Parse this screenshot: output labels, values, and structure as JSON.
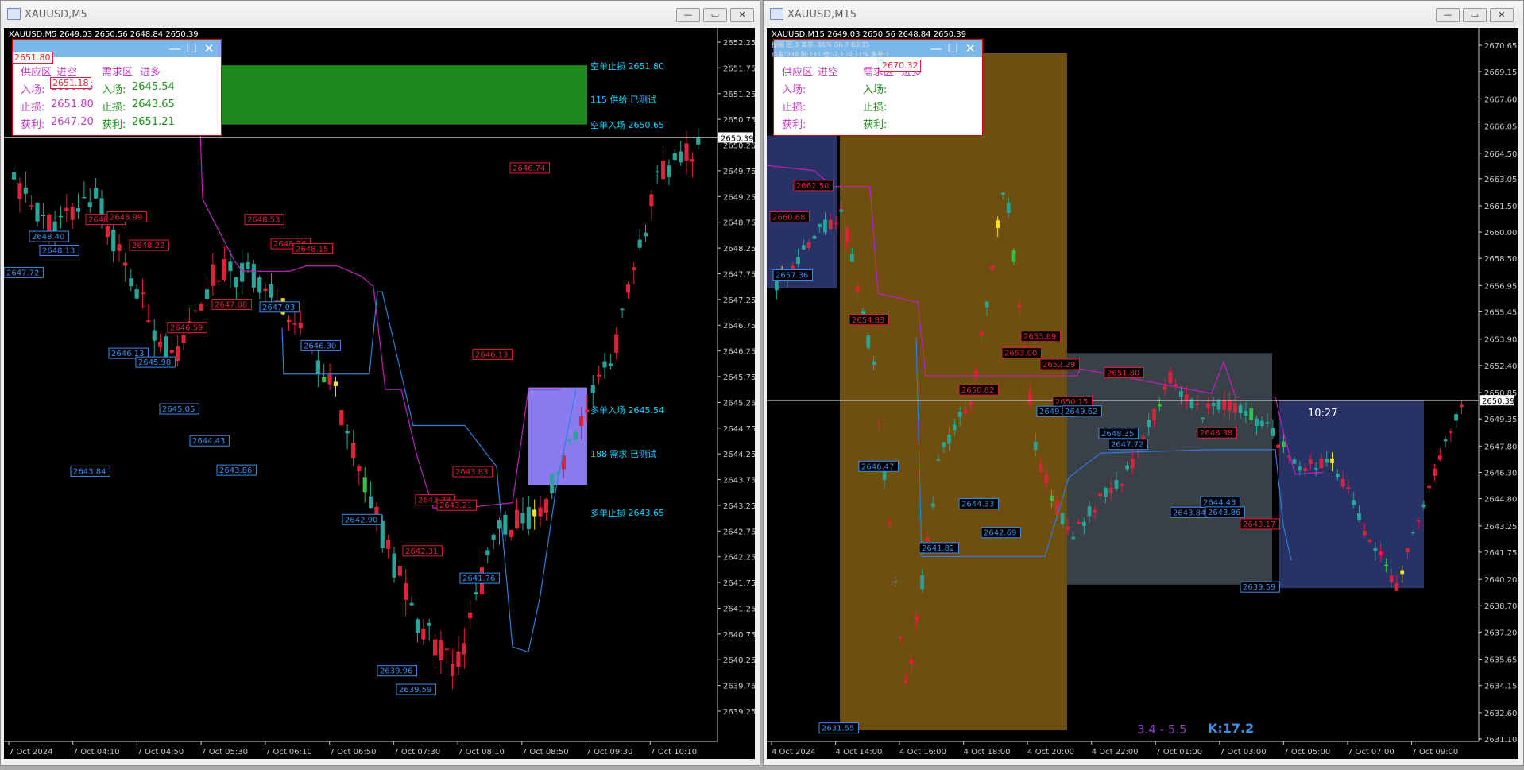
{
  "windows": [
    {
      "title": "XAUUSD,M5",
      "info": "XAUUSD,M5  2649.03 2650.56 2648.84 2650.39",
      "panel": {
        "headers": [
          "供应区",
          "进空",
          "需求区",
          "进多"
        ],
        "rows": [
          {
            "l1": "入场:",
            "v1": "2650.65",
            "l2": "入场:",
            "v2": "2645.54"
          },
          {
            "l1": "止损:",
            "v1": "2651.80",
            "l2": "止损:",
            "v2": "2643.65"
          },
          {
            "l1": "获利:",
            "v1": "2647.20",
            "l2": "获利:",
            "v2": "2651.21"
          }
        ],
        "overlays": [
          "2651.80",
          "2651.18"
        ]
      },
      "zone_labels": [
        "空单止损 2651.80",
        "115 供给 已测试",
        "空单入场 2650.65",
        "多单入场 2645.54",
        "188 需求 已测试",
        "多单止损 2643.65"
      ],
      "price_ticks": [
        "2652.25",
        "2651.75",
        "2651.25",
        "2650.75",
        "2650.25",
        "2649.75",
        "2649.25",
        "2648.75",
        "2648.25",
        "2647.75",
        "2647.25",
        "2646.75",
        "2646.25",
        "2645.75",
        "2645.25",
        "2644.75",
        "2644.25",
        "2643.75",
        "2643.25",
        "2642.75",
        "2642.25",
        "2641.75",
        "2641.25",
        "2640.75",
        "2640.25",
        "2639.75",
        "2639.25"
      ],
      "current_price": "2650.39",
      "time_ticks": [
        "7 Oct 2024",
        "7 Oct 04:10",
        "7 Oct 04:50",
        "7 Oct 05:30",
        "7 Oct 06:10",
        "7 Oct 06:50",
        "7 Oct 07:30",
        "7 Oct 08:10",
        "7 Oct 08:50",
        "7 Oct 09:30",
        "7 Oct 10:10"
      ],
      "red_labels": [
        "2648.99",
        "2648.99",
        "2648.22",
        "2648.53",
        "2648.26",
        "2648.15",
        "2647.08",
        "2646.59",
        "2646.13",
        "2646.74",
        "2643.83",
        "2643.28",
        "2643.21",
        "2642.31"
      ],
      "blue_labels": [
        "2648.40",
        "2648.13",
        "2647.03",
        "2646.30",
        "2646.13",
        "2645.98",
        "2645.05",
        "2644.43",
        "2643.84",
        "2643.86",
        "2642.90",
        "2641.76",
        "2639.96",
        "2639.59",
        "2647.72"
      ]
    },
    {
      "title": "XAUUSD,M15",
      "info": "XAUUSD,M15  2649.03 2650.56 2648.84 2650.39",
      "info2": "点差:338  剩:131  仓:-7.1 -0.11%  多单:1",
      "info3": "振幅 区:3  某参: 86%  Gh:7  B3:15",
      "panel": {
        "headers": [
          "供应区",
          "进空",
          "需求区",
          "进多"
        ],
        "rows": [
          {
            "l1": "入场:",
            "v1": "",
            "l2": "入场:",
            "v2": ""
          },
          {
            "l1": "止损:",
            "v1": "",
            "l2": "止损:",
            "v2": ""
          },
          {
            "l1": "获利:",
            "v1": "",
            "l2": "获利:",
            "v2": ""
          }
        ],
        "overlays": [
          "2670.32"
        ]
      },
      "price_ticks": [
        "2670.65",
        "2669.15",
        "2667.60",
        "2666.05",
        "2664.50",
        "2663.05",
        "2661.50",
        "2660.00",
        "2658.50",
        "2656.95",
        "2655.45",
        "2653.90",
        "2652.40",
        "2650.85",
        "2649.35",
        "2647.80",
        "2646.30",
        "2644.80",
        "2643.25",
        "2641.75",
        "2640.20",
        "2638.70",
        "2637.20",
        "2635.65",
        "2634.15",
        "2632.60",
        "2631.10"
      ],
      "current_price": "2650.39",
      "time_ticks": [
        "4 Oct 2024",
        "4 Oct 14:00",
        "4 Oct 16:00",
        "4 Oct 18:00",
        "4 Oct 20:00",
        "4 Oct 22:00",
        "7 Oct 01:00",
        "7 Oct 03:00",
        "7 Oct 05:00",
        "7 Oct 07:00",
        "7 Oct 09:00"
      ],
      "red_labels": [
        "2662.50",
        "2660.68",
        "2654.83",
        "2653.89",
        "2653.00",
        "2652.29",
        "2651.80",
        "2650.82",
        "2650.15",
        "2648.38",
        "2643.17"
      ],
      "blue_labels": [
        "2657.36",
        "2646.47",
        "2644.33",
        "2642.69",
        "2641.82",
        "2649.60",
        "2649.62",
        "2648.35",
        "2647.72",
        "2644.43",
        "2643.84",
        "2643.86",
        "2639.59",
        "2631.55"
      ],
      "countdown": "10:27",
      "footer_range": "3.4 - 5.5",
      "footer_k": "K:17.2"
    }
  ],
  "colors": {
    "bull": "#26a69a",
    "bear": "#e0213b",
    "supply_zone": "#1e8a1e",
    "demand_zone": "#8a7cf0",
    "brown_zone": "#6f4f10",
    "gray_zone": "#3a4048",
    "navy_zone": "#283265",
    "magenta_line": "#c020c0",
    "blue_line": "#2e7fd8"
  }
}
